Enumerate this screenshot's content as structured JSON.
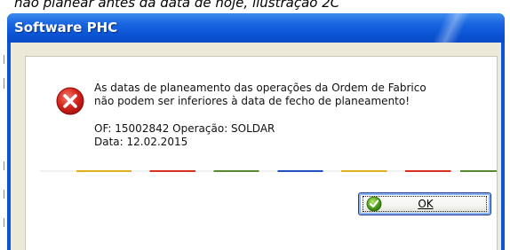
{
  "background": {
    "text": "não planear antes da data de hoje, ilustração 2C"
  },
  "dialog": {
    "title": "Software PHC",
    "message": {
      "line1": "As datas de planeamento das operações da Ordem de Fabrico",
      "line2": "não podem ser inferiores à data de fecho de planeamento!",
      "line3": "OF: 15002842 Operação: SOLDAR",
      "line4": "Data: 12.02.2015"
    },
    "icon": "error-icon",
    "ok_label": "OK",
    "ok_icon": "check-icon"
  },
  "colors": {
    "titlebar": "#0a55d4",
    "client": "#ece9d8",
    "error": "#d8251c"
  }
}
